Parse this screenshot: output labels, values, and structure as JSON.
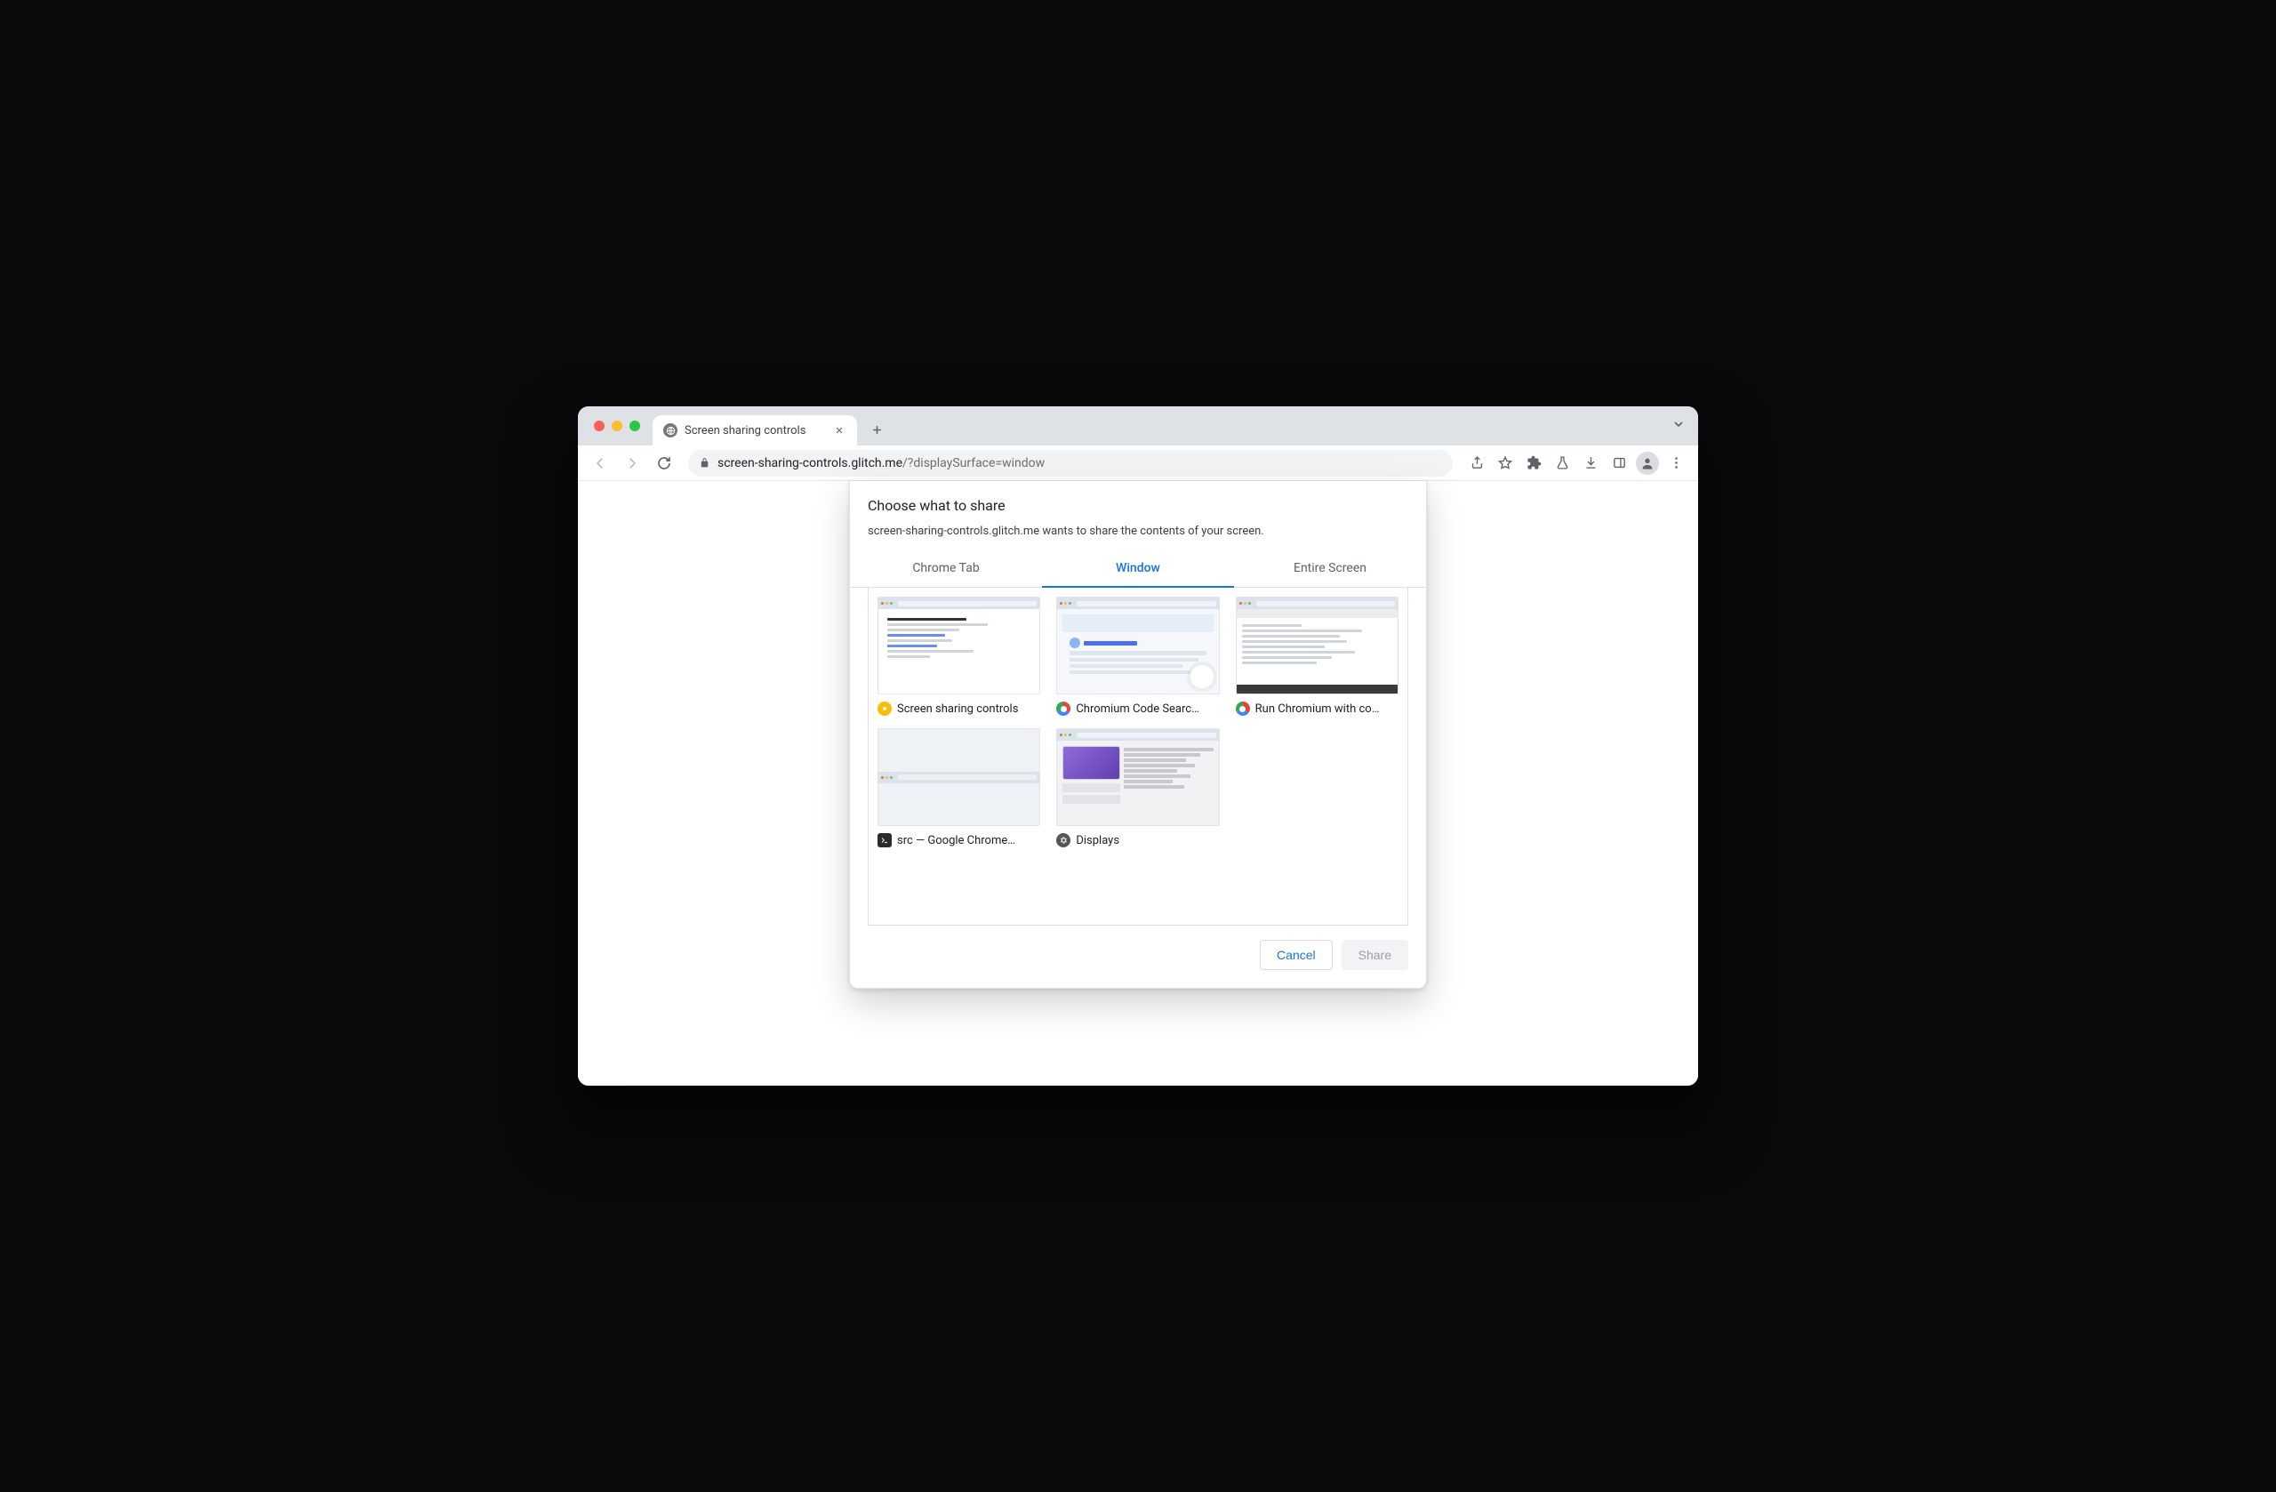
{
  "browser": {
    "tab_title": "Screen sharing controls",
    "url_host": "screen-sharing-controls.glitch.me",
    "url_path": "/?displaySurface=window"
  },
  "dialog": {
    "title": "Choose what to share",
    "subtitle": "screen-sharing-controls.glitch.me wants to share the contents of your screen.",
    "tabs": {
      "chrome_tab": "Chrome Tab",
      "window": "Window",
      "entire_screen": "Entire Screen"
    },
    "active_tab": "window",
    "sources": [
      {
        "label": "Screen sharing controls",
        "icon": "canary",
        "thumb": "text-doc"
      },
      {
        "label": "Chromium Code Searc…",
        "icon": "chrome",
        "thumb": "code-search"
      },
      {
        "label": "Run Chromium with co…",
        "icon": "chrome",
        "thumb": "code-dark"
      },
      {
        "label": "src — Google Chrome…",
        "icon": "terminal",
        "thumb": "blank"
      },
      {
        "label": "Displays",
        "icon": "settings",
        "thumb": "displays"
      }
    ],
    "buttons": {
      "cancel": "Cancel",
      "share": "Share"
    }
  }
}
